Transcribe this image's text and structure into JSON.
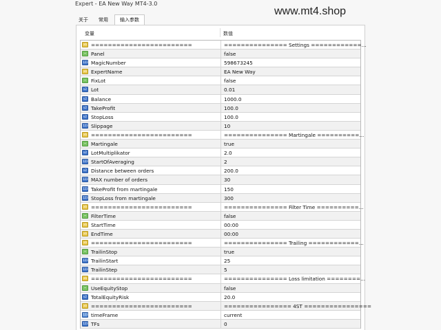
{
  "window": {
    "title": "Expert - EA New Way MT4-3.0",
    "watermark": "www.mt4.shop"
  },
  "tabs": [
    {
      "label": "关于",
      "active": false
    },
    {
      "label": "常用",
      "active": false
    },
    {
      "label": "输入参数",
      "active": true
    }
  ],
  "table": {
    "header_variable": "变量",
    "header_value": "数值",
    "rows": [
      {
        "icon": "str",
        "name": "========================",
        "value": "=============== Settings ============..."
      },
      {
        "icon": "bool",
        "name": "Panel",
        "value": "false"
      },
      {
        "icon": "int",
        "name": "MagicNumber",
        "value": "598673245"
      },
      {
        "icon": "str",
        "name": "ExpertName",
        "value": "EA New Way"
      },
      {
        "icon": "bool",
        "name": "FixLot",
        "value": "false"
      },
      {
        "icon": "dbl",
        "name": "Lot",
        "value": "0.01"
      },
      {
        "icon": "dbl",
        "name": "Balance",
        "value": "1000.0"
      },
      {
        "icon": "dbl",
        "name": "TakeProfit",
        "value": "100.0"
      },
      {
        "icon": "dbl",
        "name": "StopLoss",
        "value": "100.0"
      },
      {
        "icon": "int",
        "name": "Slippage",
        "value": "10"
      },
      {
        "icon": "str",
        "name": "========================",
        "value": "=============== Martingale ==========..."
      },
      {
        "icon": "bool",
        "name": "Martingale",
        "value": "true"
      },
      {
        "icon": "dbl",
        "name": "LotMultiplikator",
        "value": "2.0"
      },
      {
        "icon": "int",
        "name": "StartOfAveraging",
        "value": "2"
      },
      {
        "icon": "dbl",
        "name": "Distance between orders",
        "value": "200.0"
      },
      {
        "icon": "int",
        "name": "MAX number of orders",
        "value": "30"
      },
      {
        "icon": "int",
        "name": "TakeProfit from martingale",
        "value": "150"
      },
      {
        "icon": "int",
        "name": "StopLoss from martingale",
        "value": "300"
      },
      {
        "icon": "str",
        "name": "========================",
        "value": "=============== Filter Time ==========..."
      },
      {
        "icon": "bool",
        "name": "FilterTime",
        "value": "false"
      },
      {
        "icon": "str",
        "name": "StartTime",
        "value": "00:00"
      },
      {
        "icon": "str",
        "name": "EndTime",
        "value": "00:00"
      },
      {
        "icon": "str",
        "name": "========================",
        "value": "=============== Trailing ============..."
      },
      {
        "icon": "bool",
        "name": "TrailinStop",
        "value": "true"
      },
      {
        "icon": "int",
        "name": "TrailinStart",
        "value": "25"
      },
      {
        "icon": "int",
        "name": "TrailinStep",
        "value": "5"
      },
      {
        "icon": "str",
        "name": "========================",
        "value": "=============== Loss limitation ========..."
      },
      {
        "icon": "bool",
        "name": "UseEquityStop",
        "value": "false"
      },
      {
        "icon": "dbl",
        "name": "TotalEquityRisk",
        "value": "20.0"
      },
      {
        "icon": "str",
        "name": "========================",
        "value": "================ 4ST ================"
      },
      {
        "icon": "enm",
        "name": "timeFrame",
        "value": "current"
      },
      {
        "icon": "int",
        "name": "TFs",
        "value": "0"
      }
    ]
  }
}
